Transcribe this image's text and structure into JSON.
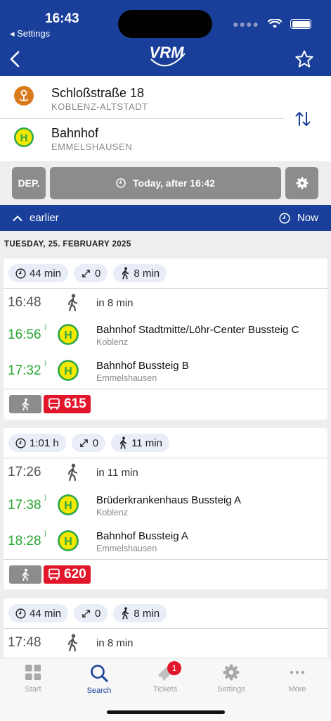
{
  "status": {
    "time": "16:43",
    "back_label": "◂ Settings"
  },
  "header": {
    "logo_text": "VRM"
  },
  "route": {
    "origin": {
      "name": "Schloßstraße 18",
      "locality": "KOBLENZ-ALTSTADT"
    },
    "destination": {
      "name": "Bahnhof",
      "locality": "EMMELSHAUSEN"
    }
  },
  "controls": {
    "mode_label": "DEP.",
    "time_label": "Today, after 16:42"
  },
  "earlier_bar": {
    "earlier_label": "earlier",
    "now_label": "Now"
  },
  "day_label": "TUESDAY, 25. FEBRUARY 2025",
  "trips": [
    {
      "duration": "44 min",
      "changes": "0",
      "walk": "8 min",
      "walk_time": "16:48",
      "walk_text": "in 8 min",
      "dep_time": "16:56",
      "dep_stop": "Bahnhof Stadtmitte/Löhr-Center Bussteig C",
      "dep_locality": "Koblenz",
      "arr_time": "17:32",
      "arr_stop": "Bahnhof Bussteig B",
      "arr_locality": "Emmelshausen",
      "line": "615"
    },
    {
      "duration": "1:01 h",
      "changes": "0",
      "walk": "11 min",
      "walk_time": "17:26",
      "walk_text": "in 11 min",
      "dep_time": "17:38",
      "dep_stop": "Brüderkrankenhaus Bussteig A",
      "dep_locality": "Koblenz",
      "arr_time": "18:28",
      "arr_stop": "Bahnhof Bussteig A",
      "arr_locality": "Emmelshausen",
      "line": "620"
    },
    {
      "duration": "44 min",
      "changes": "0",
      "walk": "8 min",
      "walk_time": "17:48",
      "walk_text": "in 8 min"
    }
  ],
  "tabbar": {
    "start": "Start",
    "search": "Search",
    "tickets": "Tickets",
    "settings": "Settings",
    "more": "More",
    "tickets_badge": "1"
  },
  "colors": {
    "brand_blue": "#1a3f9a",
    "realtime_green": "#28a832",
    "bus_red": "#e2162a",
    "stop_yellow": "#f5e800"
  }
}
